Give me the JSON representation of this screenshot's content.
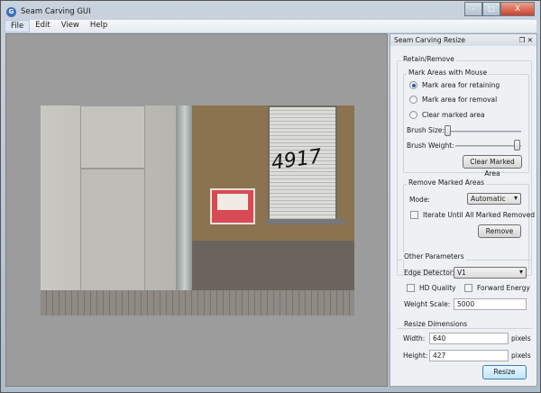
{
  "window": {
    "title": "Seam Carving GUI",
    "min": "–",
    "max": "□",
    "close": "X"
  },
  "menu": [
    "File",
    "Edit",
    "View",
    "Help"
  ],
  "panel": {
    "title": "Seam Carving Resize",
    "float_icon": "❐",
    "close_icon": "✕",
    "retain_remove": {
      "label": "Retain/Remove",
      "mark": {
        "label": "Mark Areas with Mouse",
        "options": [
          "Mark area for retaining",
          "Mark area for removal",
          "Clear marked area"
        ],
        "selected": 0,
        "brush_size_label": "Brush Size:",
        "brush_size": 0.2,
        "brush_weight_label": "Brush Weight:",
        "brush_weight": 1.0,
        "clear_button": "Clear Marked Area"
      },
      "remove": {
        "label": "Remove Marked Areas",
        "mode_label": "Mode:",
        "mode": "Automatic",
        "iterate_label": "Iterate Until All Marked Removed",
        "iterate": false,
        "remove_button": "Remove"
      }
    },
    "other": {
      "label": "Other Parameters",
      "edge_label": "Edge Detector:",
      "edge": "V1",
      "hd_label": "HD Quality",
      "forward_label": "Forward Energy",
      "weight_label": "Weight Scale:",
      "weight": "5000"
    },
    "resize": {
      "label": "Resize Dimensions",
      "width_label": "Width:",
      "width": "640",
      "height_label": "Height:",
      "height": "427",
      "unit": "pixels",
      "resize_button": "Resize"
    }
  },
  "photo": {
    "graffiti": "4917"
  }
}
